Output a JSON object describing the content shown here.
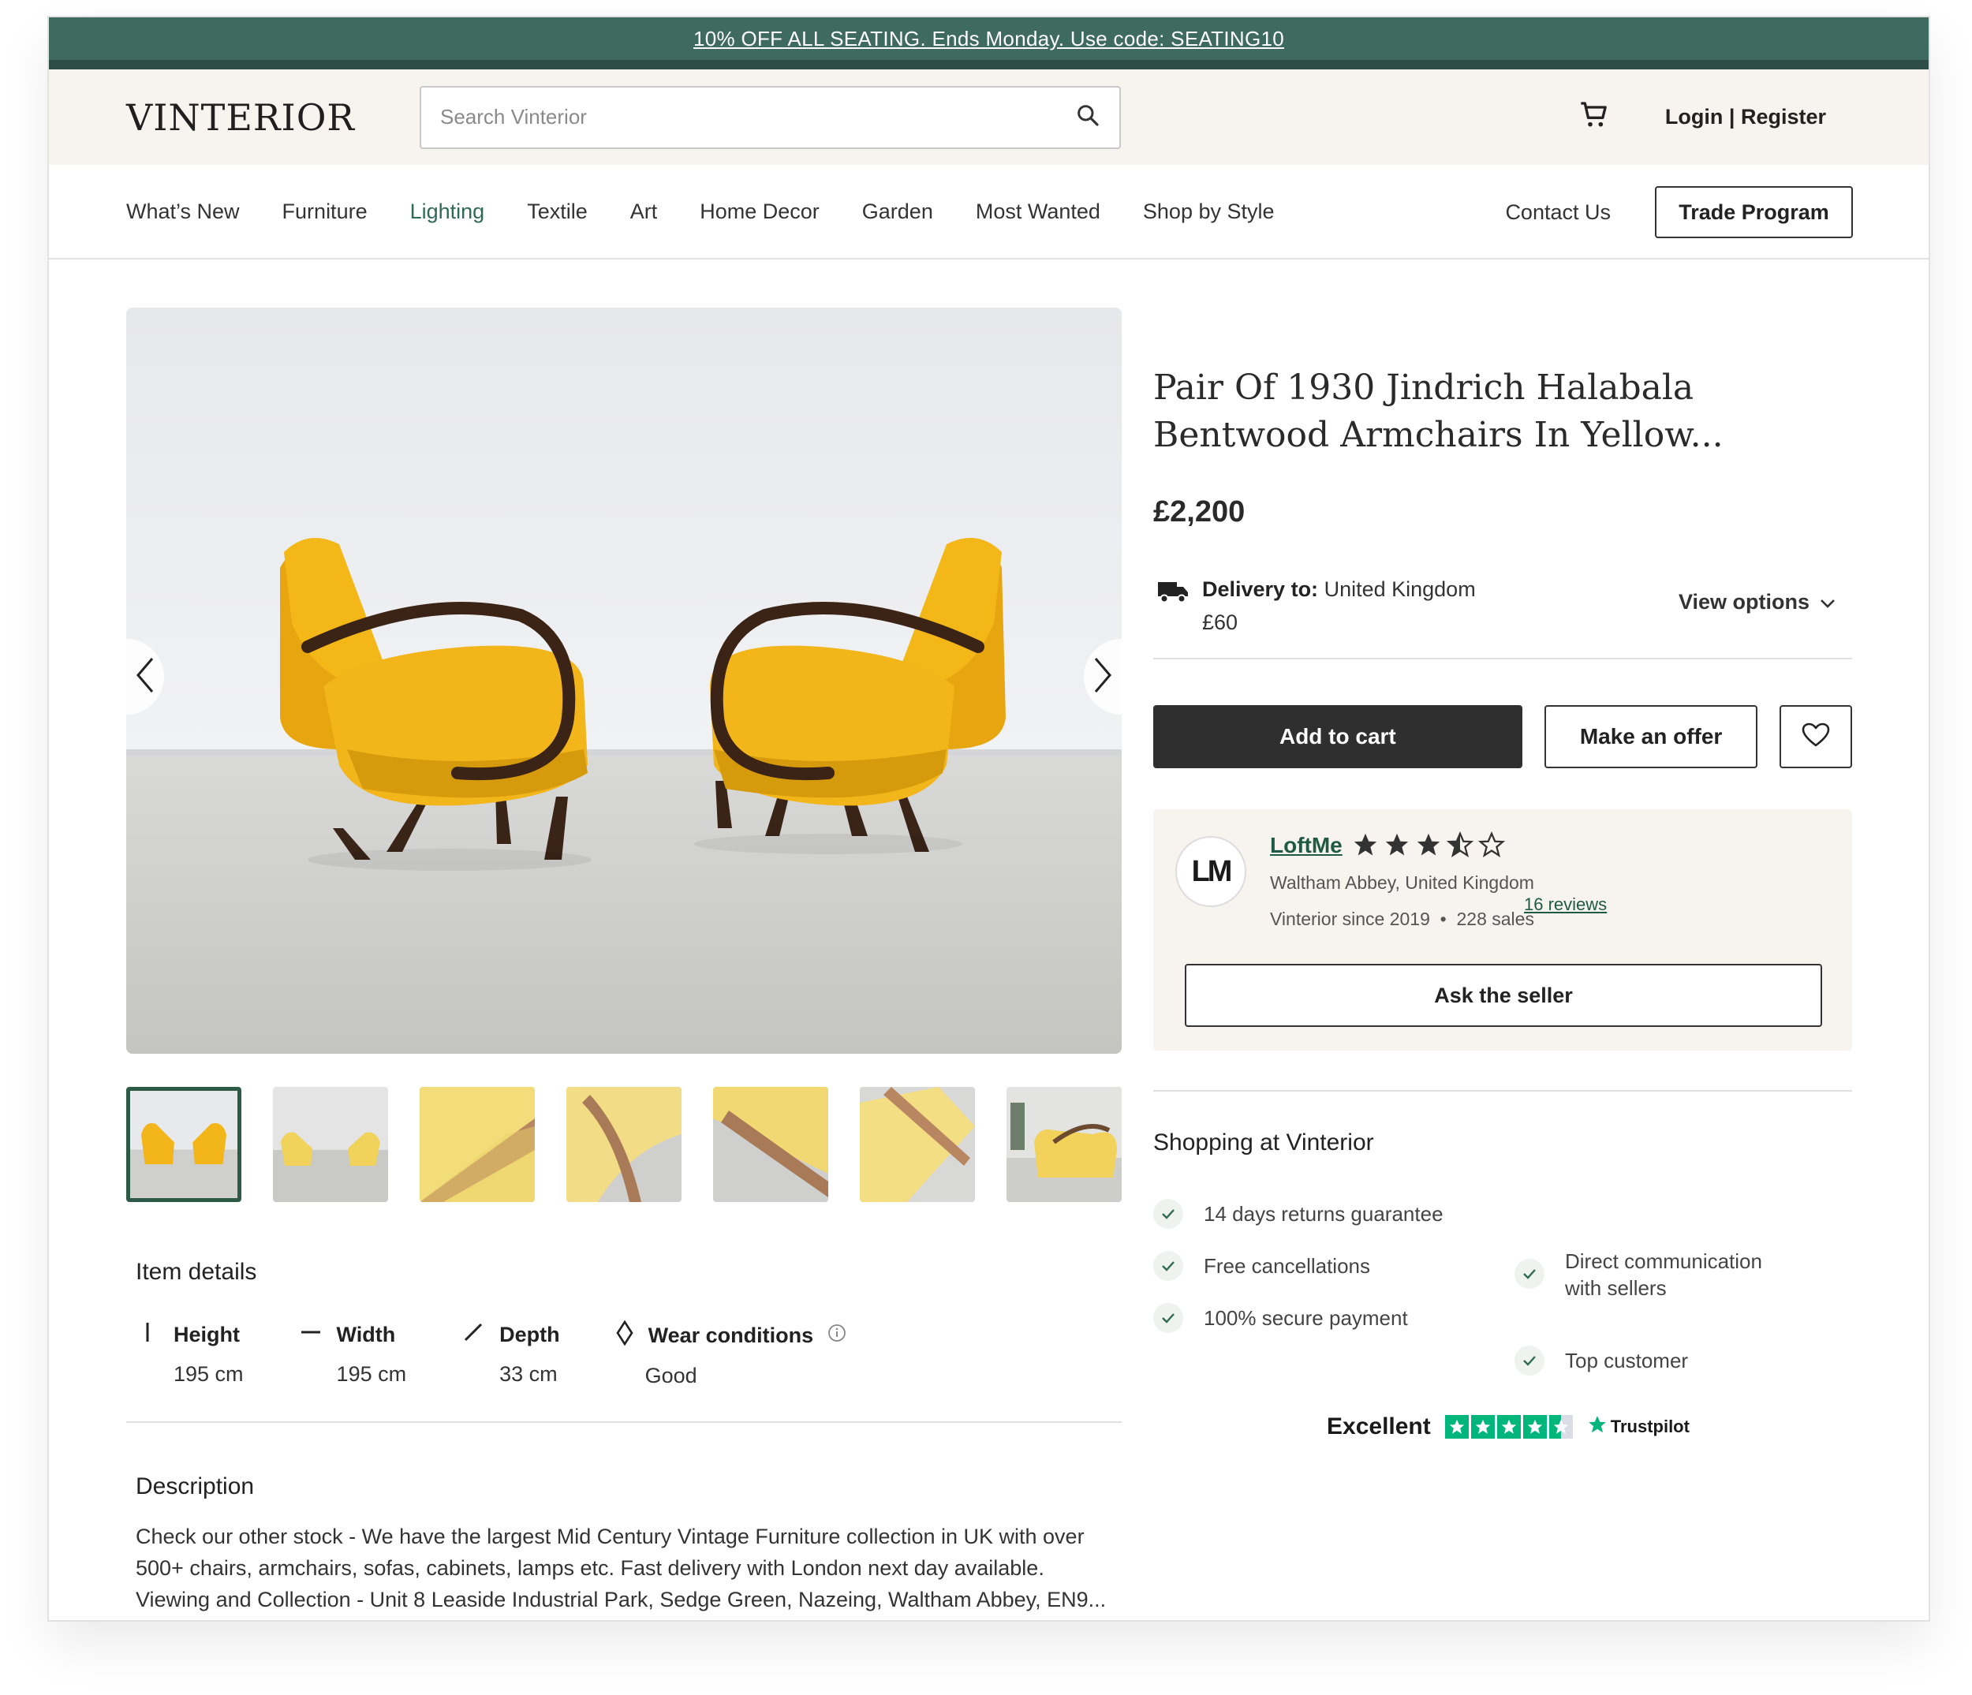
{
  "promo": {
    "text": "10% OFF ALL SEATING. Ends Monday. Use code: SEATING10"
  },
  "header": {
    "logo": "VINTERIOR",
    "search_placeholder": "Search Vinterior",
    "login": "Login | Register"
  },
  "nav": {
    "items": [
      {
        "label": "What’s New"
      },
      {
        "label": "Furniture"
      },
      {
        "label": "Lighting"
      },
      {
        "label": "Textile"
      },
      {
        "label": "Art"
      },
      {
        "label": "Home Decor"
      },
      {
        "label": "Garden"
      },
      {
        "label": "Most Wanted"
      },
      {
        "label": "Shop by Style"
      }
    ],
    "contact": "Contact Us",
    "trade": "Trade Program"
  },
  "product": {
    "title": "Pair Of 1930 Jindrich Halabala Bentwood Armchairs In Yellow...",
    "price": "£2,200",
    "delivery_label": "Delivery to:",
    "delivery_country": "United Kingdom",
    "delivery_cost": "£60",
    "view_options": "View options",
    "add_to_cart": "Add to cart",
    "make_offer": "Make an offer"
  },
  "seller": {
    "initials": "LM",
    "name": "LoftMe",
    "rating": 3.5,
    "location": "Waltham Abbey, United Kingdom",
    "reviews": "16 reviews",
    "since": "Vinterior since 2019",
    "sales": "228 sales",
    "ask": "Ask the seller"
  },
  "item_details": {
    "title": "Item details",
    "height_label": "Height",
    "height_value": "195 cm",
    "width_label": "Width",
    "width_value": "195 cm",
    "depth_label": "Depth",
    "depth_value": "33 cm",
    "wear_label": "Wear conditions",
    "wear_value": "Good"
  },
  "description": {
    "title": "Description",
    "text": "Check our other stock - We have the largest Mid Century Vintage Furniture collection in UK with over 500+ chairs, armchairs, sofas, cabinets, lamps etc. Fast delivery with London next day available. Viewing and Collection - Unit 8 Leaside Industrial Park, Sedge Green, Nazeing, Waltham Abbey, EN9..."
  },
  "shopping": {
    "title": "Shopping at Vinterior",
    "returns": "14 days returns guarantee",
    "cancellations": "Free cancellations",
    "secure": "100% secure payment",
    "communication": "Direct communication with sellers",
    "top": "Top customer"
  },
  "trustpilot": {
    "rating_word": "Excellent",
    "brand": "Trustpilot"
  },
  "colors": {
    "promo_bg": "#3e6a60",
    "accent": "#2f6a55",
    "cart_btn": "#2f2f2f",
    "header_bg": "#f7f3ee",
    "chair_yellow": "#f2b51a",
    "trustpilot_green": "#00b67a"
  }
}
